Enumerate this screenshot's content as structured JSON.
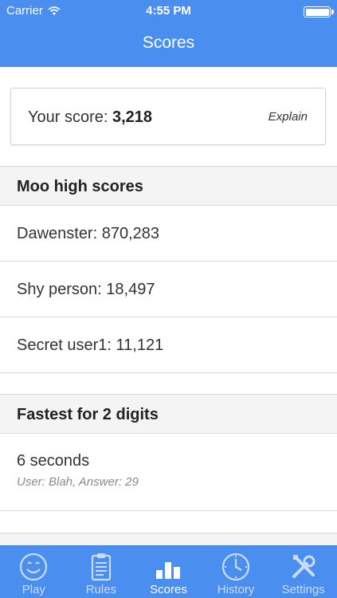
{
  "status_bar": {
    "carrier": "Carrier",
    "time": "4:55 PM"
  },
  "nav": {
    "title": "Scores"
  },
  "score_card": {
    "label": "Your score:",
    "value": "3,218",
    "explain": "Explain"
  },
  "moo_section": {
    "title": "Moo high scores",
    "rows": [
      {
        "text": "Dawenster: 870,283"
      },
      {
        "text": "Shy person: 18,497"
      },
      {
        "text": "Secret user1: 11,121"
      },
      {
        "text": ""
      }
    ]
  },
  "fastest_section": {
    "title": "Fastest for 2 digits",
    "rows": [
      {
        "text": "6 seconds",
        "sub": "User: Blah, Answer: 29"
      },
      {
        "text": ""
      }
    ]
  },
  "tabbar": {
    "tabs": [
      {
        "label": "Play",
        "icon": "smiley-icon",
        "active": false
      },
      {
        "label": "Rules",
        "icon": "clipboard-icon",
        "active": false
      },
      {
        "label": "Scores",
        "icon": "bar-chart-icon",
        "active": true
      },
      {
        "label": "History",
        "icon": "clock-icon",
        "active": false
      },
      {
        "label": "Settings",
        "icon": "tools-icon",
        "active": false
      }
    ]
  },
  "colors": {
    "accent": "#4a8ef0",
    "section_bg": "#f4f4f4",
    "divider": "#dcdcdc"
  }
}
